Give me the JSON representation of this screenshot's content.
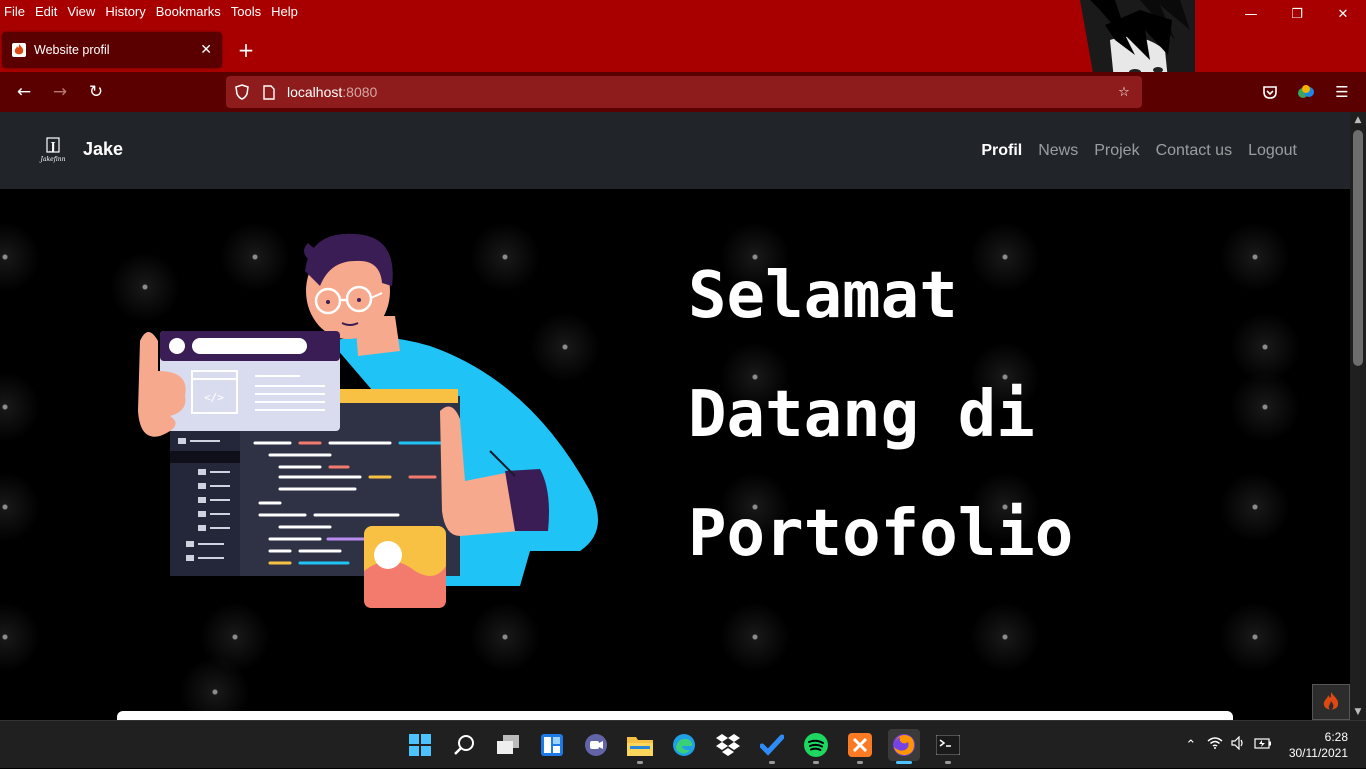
{
  "browser": {
    "menu": [
      {
        "label": "File"
      },
      {
        "label": "Edit"
      },
      {
        "label": "View"
      },
      {
        "label": "History"
      },
      {
        "label": "Bookmarks"
      },
      {
        "label": "Tools"
      },
      {
        "label": "Help"
      }
    ],
    "tab": {
      "title": "Website profil"
    },
    "url": {
      "host": "localhost",
      "port": ":8080"
    },
    "theme_color": "#a80000"
  },
  "site": {
    "brand": "Jake",
    "logo_text": "Jakefinn",
    "nav": [
      {
        "label": "Profil",
        "active": true
      },
      {
        "label": "News",
        "active": false
      },
      {
        "label": "Projek",
        "active": false
      },
      {
        "label": "Contact us",
        "active": false
      },
      {
        "label": "Logout",
        "active": false
      }
    ],
    "hero": {
      "lines": [
        "Selamat",
        "Datang di",
        "Portofolio"
      ],
      "code_tag": "</>"
    }
  },
  "taskbar": {
    "apps": [
      "start-icon",
      "search-icon",
      "task-view-icon",
      "widgets-icon",
      "teams-chat-icon",
      "file-explorer-icon",
      "edge-icon",
      "dropbox-icon",
      "todo-icon",
      "spotify-icon",
      "xampp-icon",
      "firefox-icon",
      "terminal-icon"
    ],
    "clock": {
      "time": "6:28",
      "date": "30/11/2021"
    }
  }
}
